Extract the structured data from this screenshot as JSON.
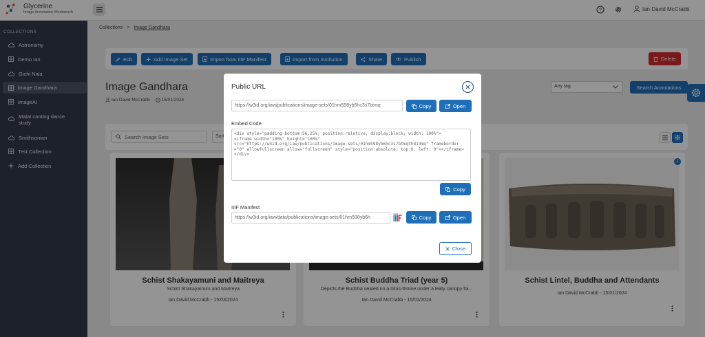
{
  "app": {
    "name": "Glycerine",
    "subtitle": "Image Annotation Workbench",
    "user": "Ian David McCrabb"
  },
  "sidebar": {
    "heading": "COLLECTIONS",
    "items": [
      {
        "label": "Astronomy",
        "icon": "cloud-icon"
      },
      {
        "label": "Demo Ian",
        "icon": "grid-icon"
      },
      {
        "label": "Gichi Nala",
        "icon": "cloud-icon"
      },
      {
        "label": "Image Gandhara",
        "icon": "grid-icon",
        "active": true
      },
      {
        "label": "ImageAI",
        "icon": "grid-icon"
      },
      {
        "label": "Malat canting dance study",
        "icon": "cloud-icon"
      },
      {
        "label": "Smithsonian",
        "icon": "cloud-icon"
      },
      {
        "label": "Test Collection",
        "icon": "grid-icon"
      },
      {
        "label": "Add Collection",
        "icon": "plus-icon"
      }
    ]
  },
  "breadcrumb": {
    "root": "Collections",
    "separator": ">",
    "current": "Image Gandhara"
  },
  "toolbar": {
    "edit": "Edit",
    "add_image_set": "Add Image Set",
    "import_iiif": "Import from IIIF Manifest",
    "import_institution": "Import from Institution",
    "share": "Share",
    "publish": "Publish",
    "delete": "Delete"
  },
  "page": {
    "title": "Image Gandhara",
    "author": "Ian David McCrabb",
    "date": "15/01/2024"
  },
  "annotations": {
    "tag_selected": "Any tag",
    "search_button": "Search Annotations"
  },
  "list": {
    "search_placeholder": "Search Image Sets",
    "sort_label": "Sort"
  },
  "cards": [
    {
      "title": "Schist Shakayamuni and Maitreya",
      "desc": "Schist Shakayamuni and Maitreya",
      "meta": "Ian David McCrabb - 15/03/2024"
    },
    {
      "title": "Schist Buddha Triad (year 5)",
      "desc": "Depicts the Buddha seated on a lotus-throne under a leafy canopy fla...",
      "meta": "Ian David McCrabb - 15/01/2024"
    },
    {
      "title": "Schist Lintel, Buddha and Attendants",
      "desc": "",
      "meta": "Ian David McCrabb - 15/01/2024",
      "badge": "1"
    }
  ],
  "modal": {
    "title": "Public URL",
    "public_url": "https://w3id.org/iaw/publications/image-sets/01hm598yb6hc3s7btmq",
    "copy": "Copy",
    "open": "Open",
    "embed_label": "Embed Code",
    "embed_code": "<div style=\"padding-bottom:56.25%; position:relative; display:block; width: 100%\">\n<iframe width=\"100%\" height=\"100%\"\nsrc=\"https://w3id.org/iaw/publications/image-sets/01hm598yb6hc3s7btmqth813mq\" frameborder=\"0\" allowfullscreen allow=\"fullscreen\" style=\"position:absolute; top:0; left: 0\"></iframe>\n</div>",
    "iiif_label": "IIIF Manifest",
    "iiif_url": "https://w3id.org/iaw/data/publications/image-sets/01hm598yb6h",
    "close": "Close"
  },
  "colors": {
    "primary": "#1f6fb8",
    "danger": "#d12c2c",
    "sidebar": "#333a4a"
  }
}
